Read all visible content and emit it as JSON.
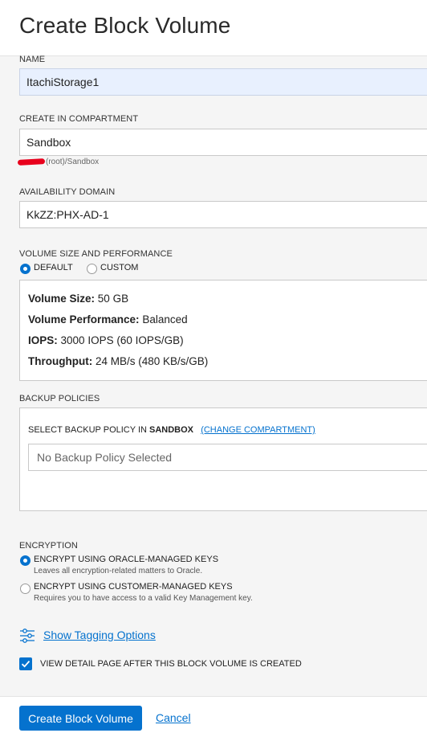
{
  "header": {
    "title": "Create Block Volume"
  },
  "name": {
    "label": "NAME",
    "value": "ItachiStorage1"
  },
  "compartment": {
    "label": "CREATE IN COMPARTMENT",
    "value": "Sandbox",
    "path": "(root)/Sandbox"
  },
  "availability_domain": {
    "label": "AVAILABILITY DOMAIN",
    "value": "KkZZ:PHX-AD-1"
  },
  "volume": {
    "label": "VOLUME SIZE AND PERFORMANCE",
    "options": [
      {
        "label": "DEFAULT",
        "selected": true
      },
      {
        "label": "CUSTOM",
        "selected": false
      }
    ],
    "details": {
      "size_label": "Volume Size:",
      "size_value": "50 GB",
      "performance_label": "Volume Performance:",
      "performance_value": "Balanced",
      "iops_label": "IOPS:",
      "iops_value": "3000 IOPS (60 IOPS/GB)",
      "throughput_label": "Throughput:",
      "throughput_value": "24 MB/s (480 KB/s/GB)"
    }
  },
  "backup": {
    "label": "BACKUP POLICIES",
    "select_prefix": "SELECT BACKUP POLICY IN",
    "compartment_name": "SANDBOX",
    "change_link": "(CHANGE COMPARTMENT)",
    "placeholder": "No Backup Policy Selected"
  },
  "encryption": {
    "label": "ENCRYPTION",
    "options": [
      {
        "label": "ENCRYPT USING ORACLE-MANAGED KEYS",
        "desc": "Leaves all encryption-related matters to Oracle.",
        "selected": true
      },
      {
        "label": "ENCRYPT USING CUSTOMER-MANAGED KEYS",
        "desc": "Requires you to have access to a valid Key Management key.",
        "selected": false
      }
    ]
  },
  "tagging": {
    "link": "Show Tagging Options",
    "icon": "sliders-icon"
  },
  "view_detail": {
    "label": "VIEW DETAIL PAGE AFTER THIS BLOCK VOLUME IS CREATED",
    "checked": true
  },
  "footer": {
    "create_label": "Create Block Volume",
    "cancel_label": "Cancel"
  },
  "colors": {
    "accent": "#0572ce",
    "redaction": "#e8001c"
  }
}
